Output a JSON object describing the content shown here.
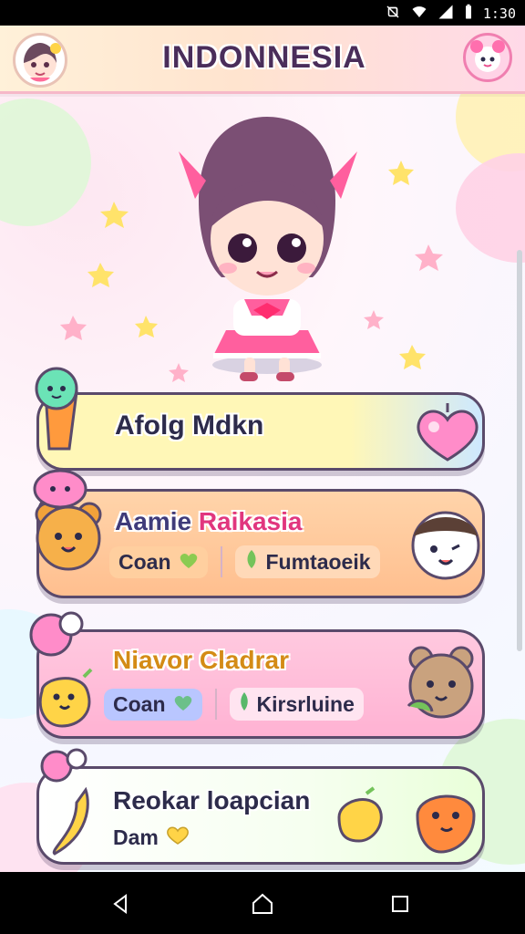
{
  "status_bar": {
    "time": "1:30",
    "icons": [
      "nfc-off-icon",
      "wifi-icon",
      "signal-icon",
      "battery-icon"
    ]
  },
  "header": {
    "title": "INDONNESIA",
    "avatar_icon": "girl-avatar-icon",
    "settings_icon": "kawaii-pet-icon"
  },
  "cards": [
    {
      "title": "Afolg Mdkn",
      "left_icon": "carrot-buddy-icon",
      "right_icon": "heart-wand-icon",
      "color": "#ffffff"
    },
    {
      "title_a": "Aamie",
      "title_b": "Raikasia",
      "sub_left": "Coan",
      "sub_right": "Fumtaoeik",
      "left_icon": "bear-buddy-icon",
      "right_icon": "panda-icon"
    },
    {
      "title": "Niavor Cladrar",
      "sub_left": "Coan",
      "sub_right": "Kirsrluine",
      "left_icon": "duck-buddy-icon",
      "right_icon": "bear-icon"
    },
    {
      "title": "Reokar loapcian",
      "sub_left": "Dam",
      "left_icon": "banana-icon",
      "mid_icon": "lemon-icon",
      "right_icon": "orange-critter-icon"
    }
  ],
  "colors": {
    "title_purple": "#4a2d5a",
    "pink_accent": "#ff5f9e",
    "card1_band_left": "#fff7b7",
    "card1_band_right": "#cde8ff",
    "card2_bg": "#ffbf8f",
    "card3_bg": "#ffb2d3",
    "card4_bg": "#e9ffd9"
  },
  "nav": {
    "back": "back-icon",
    "home": "home-icon",
    "recents": "recents-icon"
  }
}
